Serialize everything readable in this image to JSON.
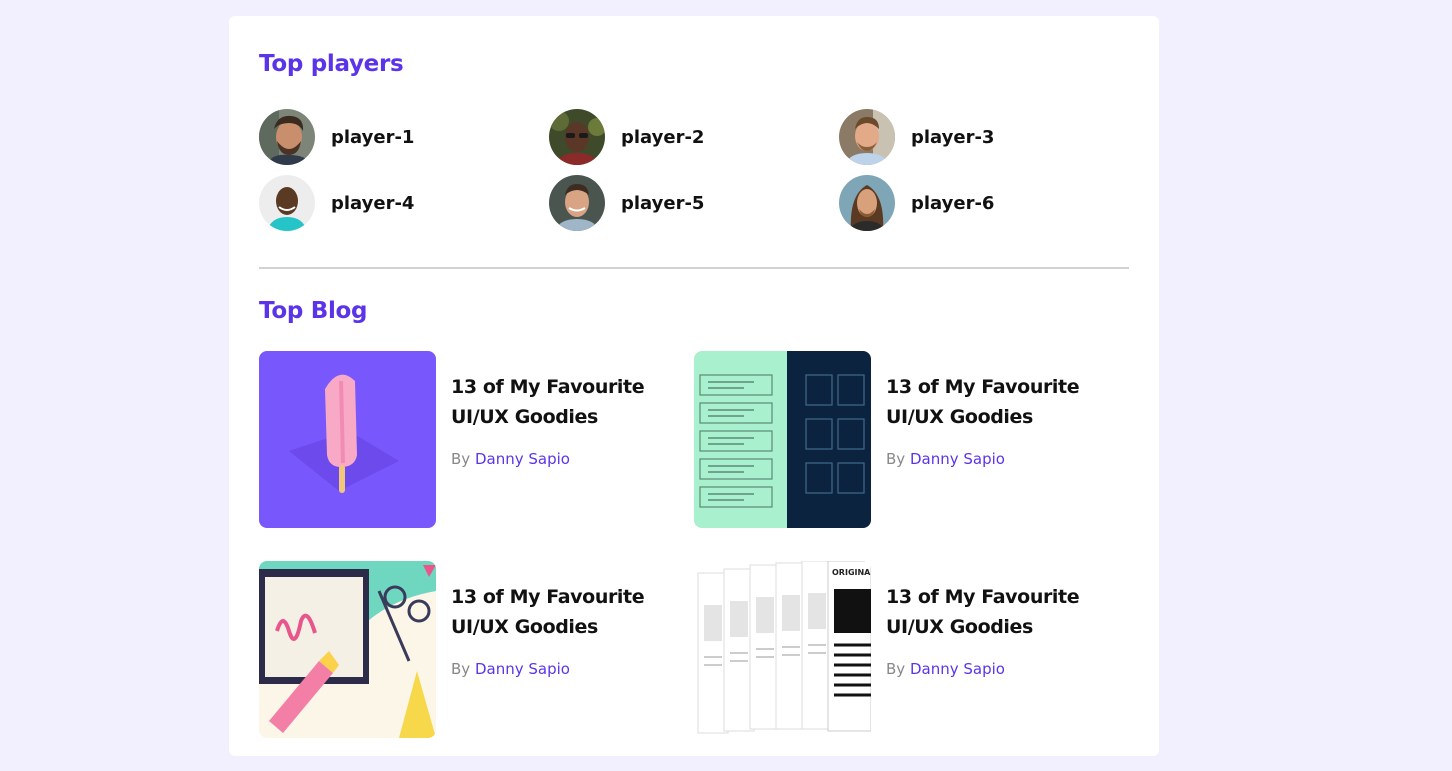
{
  "top_players": {
    "title": "Top players",
    "players": [
      {
        "name": "player-1",
        "avatar": "avatar-man-beard-curly"
      },
      {
        "name": "player-2",
        "avatar": "avatar-man-dark-glasses"
      },
      {
        "name": "player-3",
        "avatar": "avatar-man-smiling"
      },
      {
        "name": "player-4",
        "avatar": "avatar-man-bald-teal-shirt"
      },
      {
        "name": "player-5",
        "avatar": "avatar-man-short-hair"
      },
      {
        "name": "player-6",
        "avatar": "avatar-man-long-hair"
      }
    ]
  },
  "top_blog": {
    "title": "Top Blog",
    "by_label": "By",
    "posts": [
      {
        "title": "13 of My Favourite UI/UX Goodies",
        "author": "Danny Sapio",
        "thumbnail": "popsicle-illustration"
      },
      {
        "title": "13 of My Favourite UI/UX Goodies",
        "author": "Danny Sapio",
        "thumbnail": "wireframe-list-grid"
      },
      {
        "title": "13 of My Favourite UI/UX Goodies",
        "author": "Danny Sapio",
        "thumbnail": "scissors-crayon-collage"
      },
      {
        "title": "13 of My Favourite UI/UX Goodies",
        "author": "Danny Sapio",
        "thumbnail": "original-posters-stack"
      }
    ],
    "poster_label": "ORIGINA"
  },
  "colors": {
    "accent": "#5b34ea",
    "background": "#f2f0fe",
    "card": "#ffffff",
    "divider": "#d2d2d2",
    "muted_text": "#888888"
  }
}
